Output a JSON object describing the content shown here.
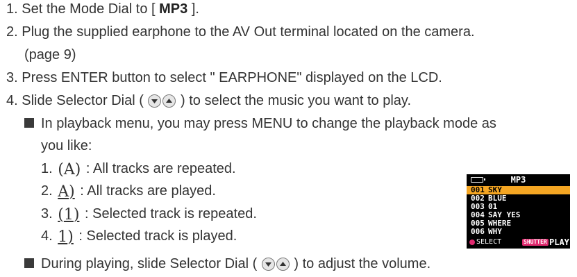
{
  "steps": [
    {
      "number": "1.",
      "before": "Set the Mode Dial to [ ",
      "bold": "MP3",
      "after": " ]."
    },
    {
      "number": "2.",
      "text": "Plug the supplied earphone to the AV Out terminal located on the camera."
    },
    {
      "number": "",
      "text": "(page 9)"
    },
    {
      "number": "3.",
      "text": "Press ENTER button to select \" EARPHONE\" displayed on the LCD."
    },
    {
      "number": "4.",
      "before": "Slide Selector Dial (",
      "after": ") to select the music you want to play."
    }
  ],
  "bullet1": {
    "line1": "In playback menu, you may press MENU to change the playback mode as",
    "line2": "you like:"
  },
  "modes": [
    {
      "number": "1.",
      "glyph": "A",
      "text": ": All tracks are repeated."
    },
    {
      "number": "2.",
      "glyph": "A",
      "text": ": All tracks are played."
    },
    {
      "number": "3.",
      "glyph": "1",
      "text": ": Selected track is repeated."
    },
    {
      "number": "4.",
      "glyph": "1",
      "text": ": Selected track is played."
    }
  ],
  "bullet2": {
    "before": "During playing, slide Selector Dial (",
    "after": ") to adjust the volume."
  },
  "lcd": {
    "title": "MP3",
    "tracks": [
      {
        "num": "001",
        "name": "SKY",
        "selected": true
      },
      {
        "num": "002",
        "name": "BLUE",
        "selected": false
      },
      {
        "num": "003",
        "name": "01",
        "selected": false
      },
      {
        "num": "004",
        "name": "SAY YES",
        "selected": false
      },
      {
        "num": "005",
        "name": "WHERE",
        "selected": false
      },
      {
        "num": "006",
        "name": "WHY",
        "selected": false
      }
    ],
    "select_label": "SELECT",
    "shutter_label": "SHUTTER",
    "play_label": "PLAY",
    "colors": {
      "highlight": "#f5a623",
      "accent": "#e02a6f"
    }
  }
}
